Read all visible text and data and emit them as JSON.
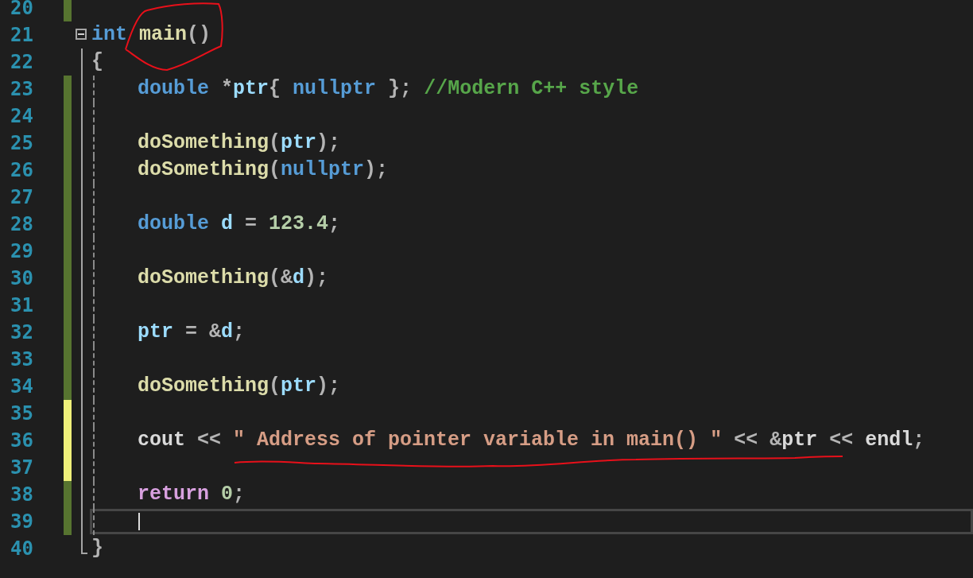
{
  "lines": [
    {
      "number": "20",
      "modified": true,
      "saved": true
    },
    {
      "number": "21",
      "modified": false,
      "expanded": true,
      "tokens": [
        {
          "kind": "keyword",
          "text": "int "
        },
        {
          "kind": "function",
          "text": "main"
        },
        {
          "kind": "punct",
          "text": "()"
        }
      ]
    },
    {
      "number": "22",
      "modified": false,
      "tokens": [
        {
          "kind": "punct",
          "text": "{"
        }
      ]
    },
    {
      "number": "23",
      "modified": true,
      "saved": true,
      "indented": true,
      "tokens": [
        {
          "kind": "keyword",
          "text": "double "
        },
        {
          "kind": "operator",
          "text": "*"
        },
        {
          "kind": "variable",
          "text": "ptr"
        },
        {
          "kind": "punct",
          "text": "{ "
        },
        {
          "kind": "keyword",
          "text": "nullptr "
        },
        {
          "kind": "punct",
          "text": "}; "
        },
        {
          "kind": "comment",
          "text": "//Modern C++ style"
        }
      ]
    },
    {
      "number": "24",
      "modified": true,
      "saved": true,
      "indented": true
    },
    {
      "number": "25",
      "modified": true,
      "saved": true,
      "indented": true,
      "tokens": [
        {
          "kind": "function",
          "text": "doSomething"
        },
        {
          "kind": "punct",
          "text": "("
        },
        {
          "kind": "variable",
          "text": "ptr"
        },
        {
          "kind": "punct",
          "text": ");"
        }
      ]
    },
    {
      "number": "26",
      "modified": true,
      "saved": true,
      "indented": true,
      "tokens": [
        {
          "kind": "function",
          "text": "doSomething"
        },
        {
          "kind": "punct",
          "text": "("
        },
        {
          "kind": "keyword",
          "text": "nullptr"
        },
        {
          "kind": "punct",
          "text": ");"
        }
      ]
    },
    {
      "number": "27",
      "modified": true,
      "saved": true,
      "indented": true
    },
    {
      "number": "28",
      "modified": true,
      "saved": true,
      "indented": true,
      "tokens": [
        {
          "kind": "keyword",
          "text": "double "
        },
        {
          "kind": "variable",
          "text": "d"
        },
        {
          "kind": "operator",
          "text": " = "
        },
        {
          "kind": "number",
          "text": "123.4"
        },
        {
          "kind": "punct",
          "text": ";"
        }
      ]
    },
    {
      "number": "29",
      "modified": true,
      "saved": true,
      "indented": true
    },
    {
      "number": "30",
      "modified": true,
      "saved": true,
      "indented": true,
      "tokens": [
        {
          "kind": "function",
          "text": "doSomething"
        },
        {
          "kind": "punct",
          "text": "("
        },
        {
          "kind": "operator",
          "text": "&"
        },
        {
          "kind": "variable",
          "text": "d"
        },
        {
          "kind": "punct",
          "text": ");"
        }
      ]
    },
    {
      "number": "31",
      "modified": true,
      "saved": true,
      "indented": true
    },
    {
      "number": "32",
      "modified": true,
      "saved": true,
      "indented": true,
      "tokens": [
        {
          "kind": "variable",
          "text": "ptr"
        },
        {
          "kind": "operator",
          "text": " = &"
        },
        {
          "kind": "variable",
          "text": "d"
        },
        {
          "kind": "punct",
          "text": ";"
        }
      ]
    },
    {
      "number": "33",
      "modified": true,
      "saved": true,
      "indented": true
    },
    {
      "number": "34",
      "modified": true,
      "saved": true,
      "indented": true,
      "tokens": [
        {
          "kind": "function",
          "text": "doSomething"
        },
        {
          "kind": "punct",
          "text": "("
        },
        {
          "kind": "variable",
          "text": "ptr"
        },
        {
          "kind": "punct",
          "text": ");"
        }
      ]
    },
    {
      "number": "35",
      "modified": true,
      "saved": false,
      "indented": true
    },
    {
      "number": "36",
      "modified": true,
      "saved": false,
      "indented": true,
      "tokens": [
        {
          "kind": "plain",
          "text": "cout "
        },
        {
          "kind": "operator",
          "text": "<< "
        },
        {
          "kind": "string",
          "text": "\" Address of pointer variable in main() \""
        },
        {
          "kind": "operator",
          "text": " << &"
        },
        {
          "kind": "plain",
          "text": "ptr"
        },
        {
          "kind": "operator",
          "text": " << "
        },
        {
          "kind": "plain",
          "text": "endl"
        },
        {
          "kind": "punct",
          "text": ";"
        }
      ]
    },
    {
      "number": "37",
      "modified": true,
      "saved": false,
      "indented": true
    },
    {
      "number": "38",
      "modified": true,
      "saved": true,
      "indented": true,
      "tokens": [
        {
          "kind": "control",
          "text": "return "
        },
        {
          "kind": "number",
          "text": "0"
        },
        {
          "kind": "punct",
          "text": ";"
        }
      ]
    },
    {
      "number": "39",
      "modified": true,
      "saved": true,
      "indented": true,
      "current": true
    },
    {
      "number": "40",
      "modified": false,
      "fold_end": true,
      "tokens": [
        {
          "kind": "punct",
          "text": "}"
        }
      ]
    }
  ],
  "annotations": {
    "circle": true,
    "underline": true
  }
}
